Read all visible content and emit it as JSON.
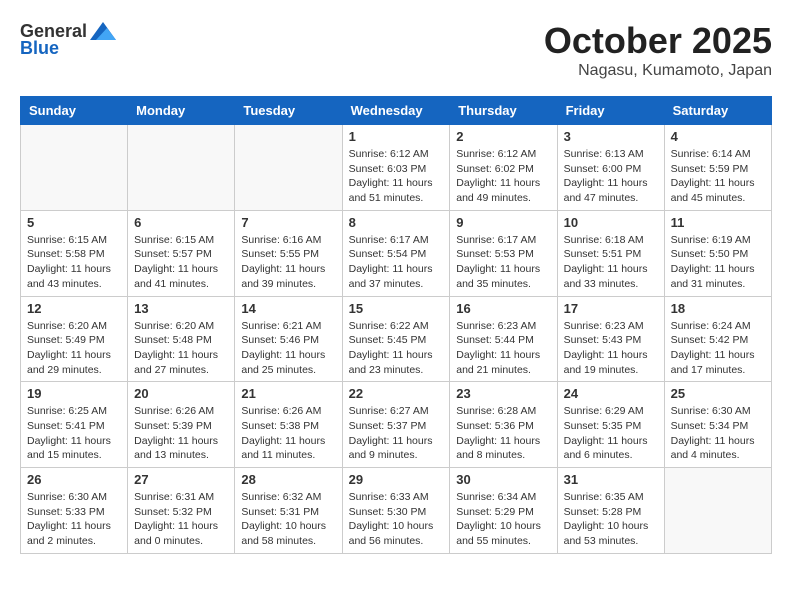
{
  "header": {
    "logo_general": "General",
    "logo_blue": "Blue",
    "month": "October 2025",
    "location": "Nagasu, Kumamoto, Japan"
  },
  "weekdays": [
    "Sunday",
    "Monday",
    "Tuesday",
    "Wednesday",
    "Thursday",
    "Friday",
    "Saturday"
  ],
  "weeks": [
    [
      {
        "day": "",
        "info": ""
      },
      {
        "day": "",
        "info": ""
      },
      {
        "day": "",
        "info": ""
      },
      {
        "day": "1",
        "info": "Sunrise: 6:12 AM\nSunset: 6:03 PM\nDaylight: 11 hours\nand 51 minutes."
      },
      {
        "day": "2",
        "info": "Sunrise: 6:12 AM\nSunset: 6:02 PM\nDaylight: 11 hours\nand 49 minutes."
      },
      {
        "day": "3",
        "info": "Sunrise: 6:13 AM\nSunset: 6:00 PM\nDaylight: 11 hours\nand 47 minutes."
      },
      {
        "day": "4",
        "info": "Sunrise: 6:14 AM\nSunset: 5:59 PM\nDaylight: 11 hours\nand 45 minutes."
      }
    ],
    [
      {
        "day": "5",
        "info": "Sunrise: 6:15 AM\nSunset: 5:58 PM\nDaylight: 11 hours\nand 43 minutes."
      },
      {
        "day": "6",
        "info": "Sunrise: 6:15 AM\nSunset: 5:57 PM\nDaylight: 11 hours\nand 41 minutes."
      },
      {
        "day": "7",
        "info": "Sunrise: 6:16 AM\nSunset: 5:55 PM\nDaylight: 11 hours\nand 39 minutes."
      },
      {
        "day": "8",
        "info": "Sunrise: 6:17 AM\nSunset: 5:54 PM\nDaylight: 11 hours\nand 37 minutes."
      },
      {
        "day": "9",
        "info": "Sunrise: 6:17 AM\nSunset: 5:53 PM\nDaylight: 11 hours\nand 35 minutes."
      },
      {
        "day": "10",
        "info": "Sunrise: 6:18 AM\nSunset: 5:51 PM\nDaylight: 11 hours\nand 33 minutes."
      },
      {
        "day": "11",
        "info": "Sunrise: 6:19 AM\nSunset: 5:50 PM\nDaylight: 11 hours\nand 31 minutes."
      }
    ],
    [
      {
        "day": "12",
        "info": "Sunrise: 6:20 AM\nSunset: 5:49 PM\nDaylight: 11 hours\nand 29 minutes."
      },
      {
        "day": "13",
        "info": "Sunrise: 6:20 AM\nSunset: 5:48 PM\nDaylight: 11 hours\nand 27 minutes."
      },
      {
        "day": "14",
        "info": "Sunrise: 6:21 AM\nSunset: 5:46 PM\nDaylight: 11 hours\nand 25 minutes."
      },
      {
        "day": "15",
        "info": "Sunrise: 6:22 AM\nSunset: 5:45 PM\nDaylight: 11 hours\nand 23 minutes."
      },
      {
        "day": "16",
        "info": "Sunrise: 6:23 AM\nSunset: 5:44 PM\nDaylight: 11 hours\nand 21 minutes."
      },
      {
        "day": "17",
        "info": "Sunrise: 6:23 AM\nSunset: 5:43 PM\nDaylight: 11 hours\nand 19 minutes."
      },
      {
        "day": "18",
        "info": "Sunrise: 6:24 AM\nSunset: 5:42 PM\nDaylight: 11 hours\nand 17 minutes."
      }
    ],
    [
      {
        "day": "19",
        "info": "Sunrise: 6:25 AM\nSunset: 5:41 PM\nDaylight: 11 hours\nand 15 minutes."
      },
      {
        "day": "20",
        "info": "Sunrise: 6:26 AM\nSunset: 5:39 PM\nDaylight: 11 hours\nand 13 minutes."
      },
      {
        "day": "21",
        "info": "Sunrise: 6:26 AM\nSunset: 5:38 PM\nDaylight: 11 hours\nand 11 minutes."
      },
      {
        "day": "22",
        "info": "Sunrise: 6:27 AM\nSunset: 5:37 PM\nDaylight: 11 hours\nand 9 minutes."
      },
      {
        "day": "23",
        "info": "Sunrise: 6:28 AM\nSunset: 5:36 PM\nDaylight: 11 hours\nand 8 minutes."
      },
      {
        "day": "24",
        "info": "Sunrise: 6:29 AM\nSunset: 5:35 PM\nDaylight: 11 hours\nand 6 minutes."
      },
      {
        "day": "25",
        "info": "Sunrise: 6:30 AM\nSunset: 5:34 PM\nDaylight: 11 hours\nand 4 minutes."
      }
    ],
    [
      {
        "day": "26",
        "info": "Sunrise: 6:30 AM\nSunset: 5:33 PM\nDaylight: 11 hours\nand 2 minutes."
      },
      {
        "day": "27",
        "info": "Sunrise: 6:31 AM\nSunset: 5:32 PM\nDaylight: 11 hours\nand 0 minutes."
      },
      {
        "day": "28",
        "info": "Sunrise: 6:32 AM\nSunset: 5:31 PM\nDaylight: 10 hours\nand 58 minutes."
      },
      {
        "day": "29",
        "info": "Sunrise: 6:33 AM\nSunset: 5:30 PM\nDaylight: 10 hours\nand 56 minutes."
      },
      {
        "day": "30",
        "info": "Sunrise: 6:34 AM\nSunset: 5:29 PM\nDaylight: 10 hours\nand 55 minutes."
      },
      {
        "day": "31",
        "info": "Sunrise: 6:35 AM\nSunset: 5:28 PM\nDaylight: 10 hours\nand 53 minutes."
      },
      {
        "day": "",
        "info": ""
      }
    ]
  ]
}
